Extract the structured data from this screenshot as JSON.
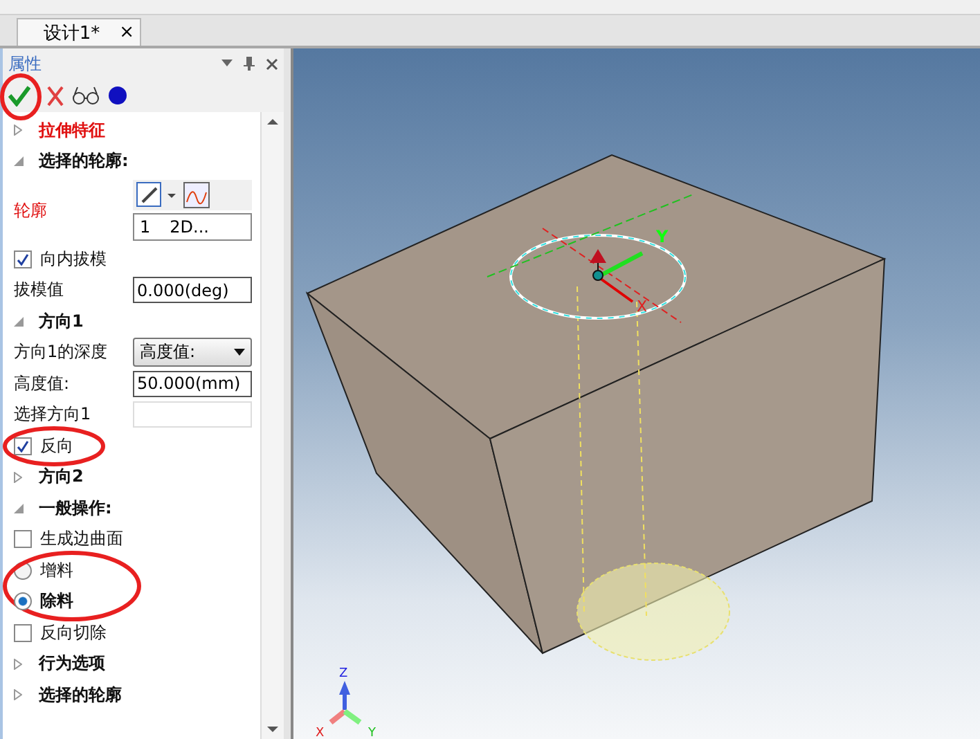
{
  "document_tab": {
    "title": "设计1*",
    "close": "×"
  },
  "panel": {
    "title": "属性",
    "check_circled": true,
    "rows": [
      {
        "kind": "title",
        "label": "拉伸特征",
        "expanded": false
      },
      {
        "kind": "section",
        "label": "选择的轮廓:",
        "expanded": true
      },
      {
        "kind": "profile",
        "label": "轮廓",
        "items": [
          {
            "index": "1",
            "name": "2D..."
          }
        ]
      },
      {
        "kind": "checkbox",
        "label": "向内拔模",
        "checked": true
      },
      {
        "kind": "field",
        "label": "拔模值",
        "value": "0.000(deg)"
      },
      {
        "kind": "section",
        "label": "方向1",
        "expanded": true
      },
      {
        "kind": "dropdown",
        "label": "方向1的深度",
        "value": "高度值:"
      },
      {
        "kind": "field",
        "label": "高度值:",
        "value": "50.000(mm)"
      },
      {
        "kind": "field",
        "label": "选择方向1"
      },
      {
        "kind": "checkbox",
        "label": "反向",
        "checked": true,
        "circled": true
      },
      {
        "kind": "section",
        "label": "方向2",
        "expanded": false
      },
      {
        "kind": "section",
        "label": "一般操作:",
        "expanded": true
      },
      {
        "kind": "checkbox",
        "label": "生成边曲面",
        "checked": false
      },
      {
        "kind": "radio",
        "label": "增料",
        "selected": false,
        "circled": true
      },
      {
        "kind": "radio",
        "label": "除料",
        "selected": true
      },
      {
        "kind": "checkbox",
        "label": "反向切除",
        "checked": false
      },
      {
        "kind": "section",
        "label": "行为选项",
        "expanded": false
      },
      {
        "kind": "section",
        "label": "选择的轮廓",
        "expanded": false
      }
    ]
  },
  "triad": {
    "x": "X",
    "y": "Y",
    "z": "Z"
  },
  "manipulator": {
    "x": "X",
    "y": "Y"
  }
}
